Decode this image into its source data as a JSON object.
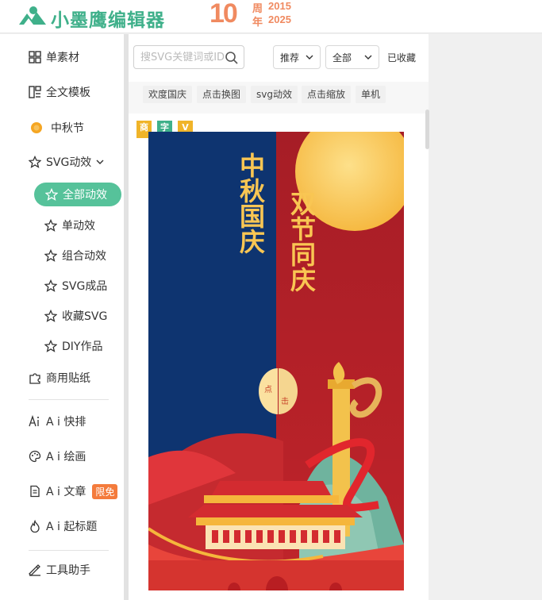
{
  "header": {
    "brand": "小墨鹰编辑器",
    "anniversary": {
      "number": "10",
      "zhou": "周",
      "nian": "年",
      "year_start": "2015",
      "year_end": "2025"
    }
  },
  "sidebar": {
    "items": [
      {
        "label": "单素材",
        "icon": "grid-icon"
      },
      {
        "label": "全文模板",
        "icon": "layout-icon"
      },
      {
        "label": "中秋节",
        "icon": "moon-dot-icon"
      },
      {
        "label": "SVG动效",
        "icon": "star-outline-icon",
        "expanded": true
      },
      {
        "label": "商用贴纸",
        "icon": "puzzle-icon"
      },
      {
        "label": "A i 快排",
        "icon": "ai-icon"
      },
      {
        "label": "A i 绘画",
        "icon": "palette-icon"
      },
      {
        "label": "A i 文章",
        "icon": "doc-icon",
        "badge": "限免"
      },
      {
        "label": "A i 起标题",
        "icon": "flame-icon"
      },
      {
        "label": "工具助手",
        "icon": "tool-icon"
      }
    ],
    "subitems": [
      {
        "label": "全部动效",
        "active": true
      },
      {
        "label": "单动效"
      },
      {
        "label": "组合动效"
      },
      {
        "label": "SVG成品"
      },
      {
        "label": "收藏SVG"
      },
      {
        "label": "DIY作品"
      }
    ]
  },
  "toolbar": {
    "search_placeholder": "搜SVG关键词或ID",
    "sort_value": "推荐",
    "filter_value": "全部",
    "favorites_label": "已收藏"
  },
  "tags": [
    "欢度国庆",
    "点击换图",
    "svg动效",
    "点击缩放",
    "单机"
  ],
  "card": {
    "mini_tags": [
      {
        "label": "商",
        "color": "#f0b429"
      },
      {
        "label": "字",
        "color": "#3fb08a"
      },
      {
        "label": "V",
        "color": "#f0b429"
      }
    ],
    "poster": {
      "left_text": "中秋国庆",
      "right_text": "双节同庆",
      "click_text_1": "点",
      "click_text_2": "击"
    }
  },
  "colors": {
    "accent": "#56c29a",
    "brand": "#3fb08a",
    "navy": "#0e3470",
    "red": "#b71d24",
    "gold": "#f9c653"
  }
}
